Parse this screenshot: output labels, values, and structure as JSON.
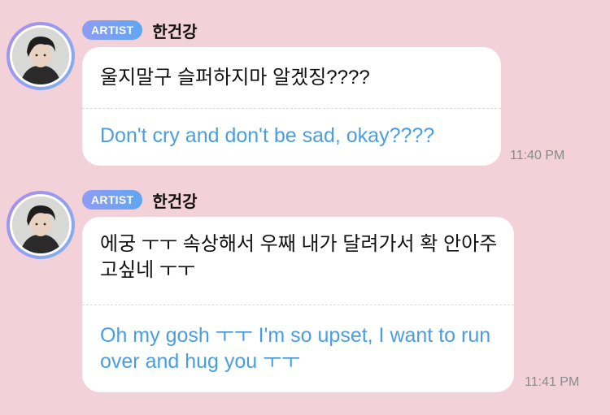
{
  "messages": [
    {
      "badge": "ARTIST",
      "sender": "한건강",
      "original": "울지말구 슬퍼하지마 알겠징????",
      "translation": "Don't cry and don't be sad, okay????",
      "time": "11:40 PM"
    },
    {
      "badge": "ARTIST",
      "sender": "한건강",
      "original": "에궁 ㅜㅜ 속상해서 우째 내가 달려가서 확 안아주고싶네 ㅜㅜ",
      "translation": "Oh my gosh ㅜㅜ I'm so upset, I want to run over and hug you ㅜㅜ",
      "time": "11:41 PM"
    }
  ]
}
